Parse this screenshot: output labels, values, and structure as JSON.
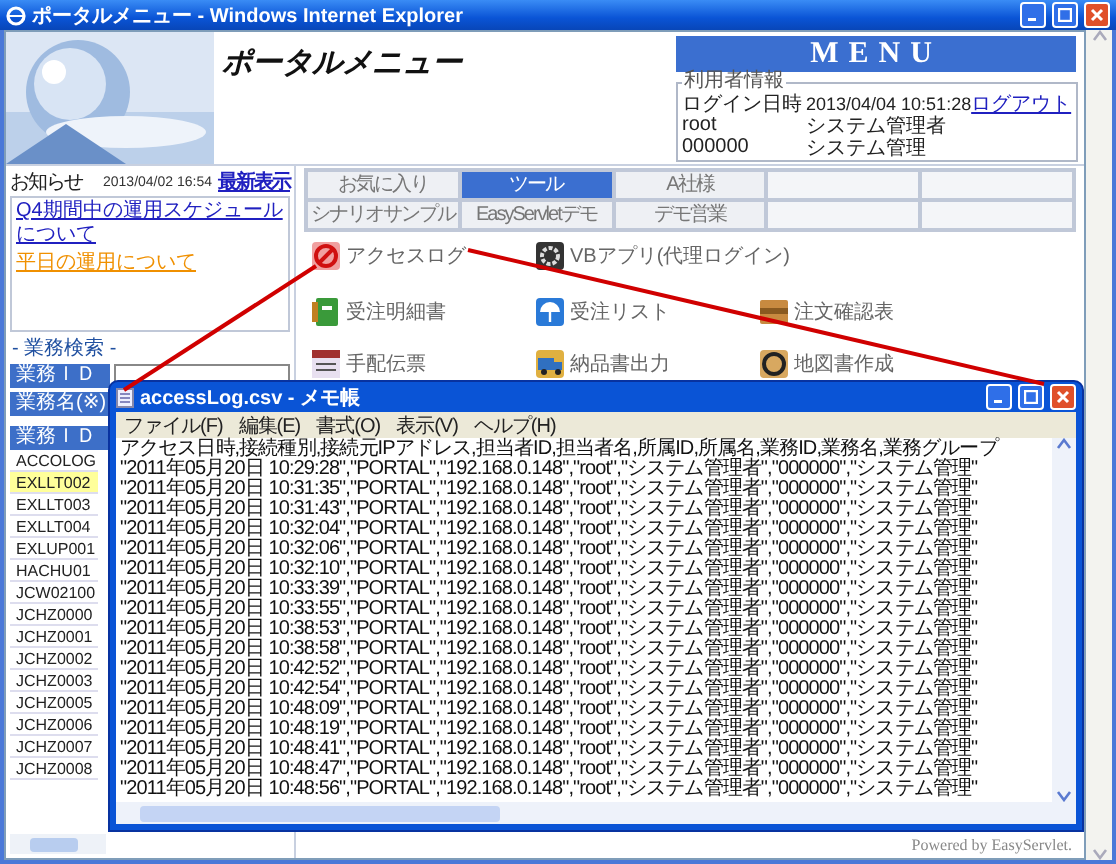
{
  "window": {
    "title": "ポータルメニュー - Windows Internet Explorer"
  },
  "header": {
    "title": "ポータルメニュー",
    "menu_label": "MENU",
    "user_info": {
      "legend": "利用者情報",
      "login_label": "ログイン日時",
      "login_time": "2013/04/04 10:51:28",
      "logout": "ログアウト",
      "user_id": "root",
      "user_name": "システム管理者",
      "dept_id": "000000",
      "dept_name": "システム管理"
    }
  },
  "notices": {
    "title": "お知らせ",
    "date": "2013/04/02 16:54",
    "refresh": "最新表示",
    "links": [
      {
        "text": "Q4期間中の運用スケジュールについて",
        "kind": "normal"
      },
      {
        "text": "平日の運用について",
        "kind": "highlight"
      }
    ]
  },
  "search": {
    "title": "- 業務検索 -",
    "fields": [
      "業務ＩＤ",
      "業務名(※)"
    ]
  },
  "task_table": {
    "column_1": "業務ＩＤ",
    "rows": [
      {
        "id": "ACCOLOG",
        "selected": false
      },
      {
        "id": "EXLLT002",
        "selected": true
      },
      {
        "id": "EXLLT003",
        "selected": false
      },
      {
        "id": "EXLLT004",
        "selected": false
      },
      {
        "id": "EXLUP001",
        "selected": false
      },
      {
        "id": "HACHU01",
        "selected": false
      },
      {
        "id": "JCW02100",
        "selected": false
      },
      {
        "id": "JCHZ0000",
        "selected": false
      },
      {
        "id": "JCHZ0001",
        "selected": false
      },
      {
        "id": "JCHZ0002",
        "selected": false
      },
      {
        "id": "JCHZ0003",
        "selected": false
      },
      {
        "id": "JCHZ0005",
        "selected": false
      },
      {
        "id": "JCHZ0006",
        "selected": false
      },
      {
        "id": "JCHZ0007",
        "selected": false
      },
      {
        "id": "JCHZ0008",
        "selected": false
      }
    ]
  },
  "tabs": [
    [
      {
        "label": "お気に入り",
        "selected": false
      },
      {
        "label": "ツール",
        "selected": true
      },
      {
        "label": "A社様",
        "selected": false
      }
    ],
    [
      {
        "label": "シナリオサンプル",
        "selected": false
      },
      {
        "label": "EasyServletデモ",
        "selected": false
      },
      {
        "label": "デモ営業",
        "selected": false
      }
    ]
  ],
  "menu_groups": [
    {
      "items": [
        "アクセスログ",
        "VBアプリ(代理ログイン)"
      ]
    },
    {
      "items": [
        "受注明細書",
        "受注リスト",
        "注文確認表",
        "手配伝票",
        "納品書出力",
        "地図書作成"
      ]
    }
  ],
  "footer": "Powered by EasyServlet.",
  "notepad": {
    "title": "accessLog.csv - メモ帳",
    "menu": [
      "ファイル(F)",
      "編集(E)",
      "書式(O)",
      "表示(V)",
      "ヘルプ(H)"
    ],
    "lines": [
      "アクセス日時,接続種別,接続元IPアドレス,担当者ID,担当者名,所属ID,所属名,業務ID,業務名,業務グループ",
      "\"2011年05月20日 10:29:28\",\"PORTAL\",\"192.168.0.148\",\"root\",\"システム管理者\",\"000000\",\"システム管理\"",
      "\"2011年05月20日 10:31:35\",\"PORTAL\",\"192.168.0.148\",\"root\",\"システム管理者\",\"000000\",\"システム管理\"",
      "\"2011年05月20日 10:31:43\",\"PORTAL\",\"192.168.0.148\",\"root\",\"システム管理者\",\"000000\",\"システム管理\"",
      "\"2011年05月20日 10:32:04\",\"PORTAL\",\"192.168.0.148\",\"root\",\"システム管理者\",\"000000\",\"システム管理\"",
      "\"2011年05月20日 10:32:06\",\"PORTAL\",\"192.168.0.148\",\"root\",\"システム管理者\",\"000000\",\"システム管理\"",
      "\"2011年05月20日 10:32:10\",\"PORTAL\",\"192.168.0.148\",\"root\",\"システム管理者\",\"000000\",\"システム管理\"",
      "\"2011年05月20日 10:33:39\",\"PORTAL\",\"192.168.0.148\",\"root\",\"システム管理者\",\"000000\",\"システム管理\"",
      "\"2011年05月20日 10:33:55\",\"PORTAL\",\"192.168.0.148\",\"root\",\"システム管理者\",\"000000\",\"システム管理\"",
      "\"2011年05月20日 10:38:53\",\"PORTAL\",\"192.168.0.148\",\"root\",\"システム管理者\",\"000000\",\"システム管理\"",
      "\"2011年05月20日 10:38:58\",\"PORTAL\",\"192.168.0.148\",\"root\",\"システム管理者\",\"000000\",\"システム管理\"",
      "\"2011年05月20日 10:42:52\",\"PORTAL\",\"192.168.0.148\",\"root\",\"システム管理者\",\"000000\",\"システム管理\"",
      "\"2011年05月20日 10:42:54\",\"PORTAL\",\"192.168.0.148\",\"root\",\"システム管理者\",\"000000\",\"システム管理\"",
      "\"2011年05月20日 10:48:09\",\"PORTAL\",\"192.168.0.148\",\"root\",\"システム管理者\",\"000000\",\"システム管理\"",
      "\"2011年05月20日 10:48:19\",\"PORTAL\",\"192.168.0.148\",\"root\",\"システム管理者\",\"000000\",\"システム管理\"",
      "\"2011年05月20日 10:48:41\",\"PORTAL\",\"192.168.0.148\",\"root\",\"システム管理者\",\"000000\",\"システム管理\"",
      "\"2011年05月20日 10:48:47\",\"PORTAL\",\"192.168.0.148\",\"root\",\"システム管理者\",\"000000\",\"システム管理\"",
      "\"2011年05月20日 10:48:56\",\"PORTAL\",\"192.168.0.148\",\"root\",\"システム管理者\",\"000000\",\"システム管理\""
    ]
  }
}
